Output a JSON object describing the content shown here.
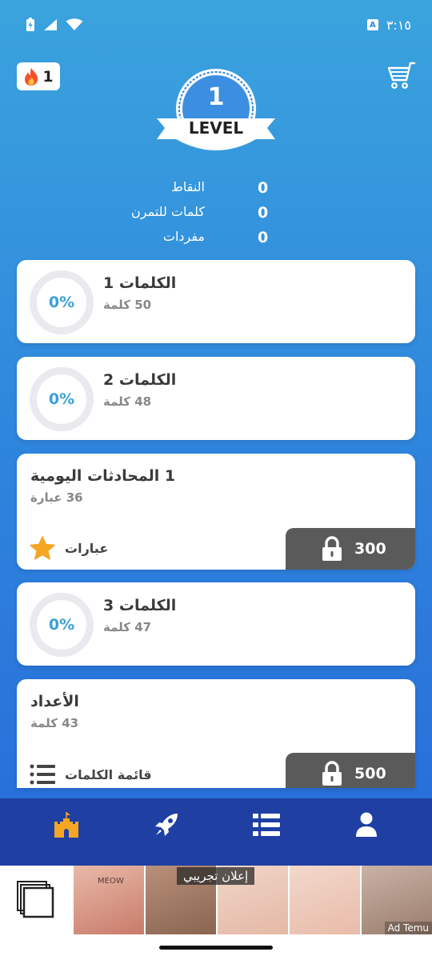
{
  "status_bar": {
    "time": "٣:١٥",
    "keyboard_badge": "A"
  },
  "header": {
    "streak_count": "1",
    "level_number": "1",
    "level_label": "LEVEL"
  },
  "stats": [
    {
      "label": "النقاط",
      "value": "0"
    },
    {
      "label": "كلمات للتمرن",
      "value": "0"
    },
    {
      "label": "مفردات",
      "value": "0"
    }
  ],
  "cards": [
    {
      "title": "الكلمات 1",
      "subtitle": "50 كلمة",
      "progress": "0%"
    },
    {
      "title": "الكلمات 2",
      "subtitle": "48 كلمة",
      "progress": "0%"
    },
    {
      "title": "1 المحادثات اليومية",
      "subtitle": "36 عبارة",
      "action_label": "عبارات",
      "lock_cost": "300"
    },
    {
      "title": "الكلمات 3",
      "subtitle": "47 كلمة",
      "progress": "0%"
    },
    {
      "title": "الأعداد",
      "subtitle": "43 كلمة",
      "action_label": "قائمة الكلمات",
      "lock_cost": "500"
    }
  ],
  "bottom_nav": [
    "castle-icon",
    "rocket-icon",
    "list-icon",
    "user-icon"
  ],
  "ad": {
    "label": "إعلان تجريبي",
    "brand": "Ad Temu",
    "shirt_text": "MEOW"
  },
  "colors": {
    "accent": "#3aa0d8",
    "nav": "#1f3fa3",
    "lock": "#5a5a5a",
    "star": "#f5a623"
  }
}
